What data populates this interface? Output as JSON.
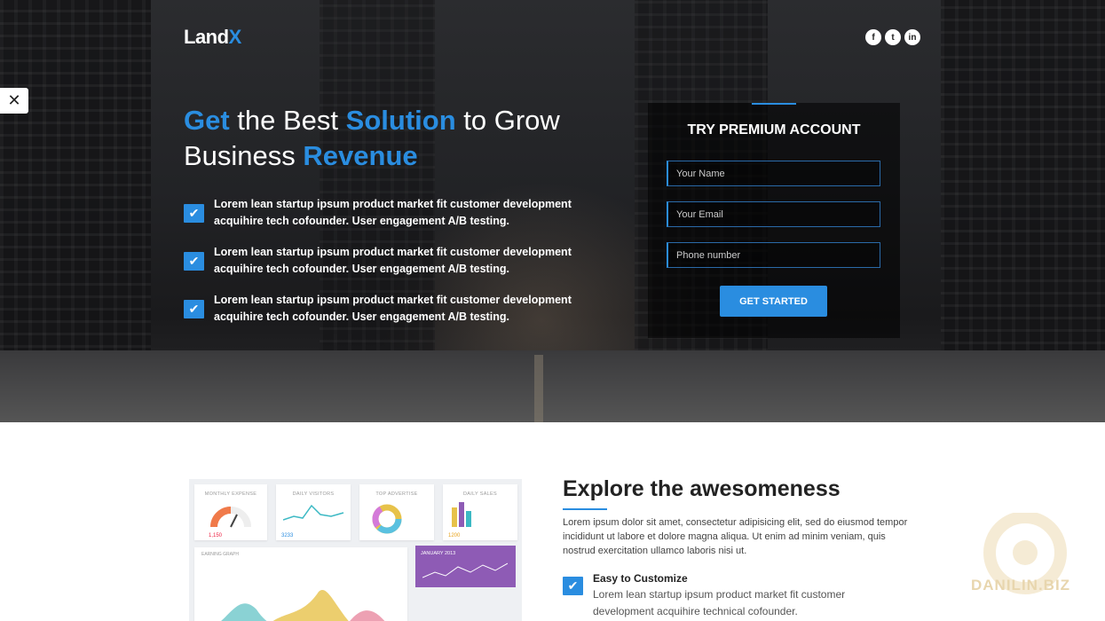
{
  "header": {
    "logo_main": "Land",
    "logo_accent": "X",
    "social": [
      {
        "icon": "facebook-icon",
        "glyph": "f"
      },
      {
        "icon": "twitter-icon",
        "glyph": "t"
      },
      {
        "icon": "linkedin-icon",
        "glyph": "in"
      }
    ]
  },
  "sidebar_tool": {
    "icon": "tools-icon",
    "glyph": "✕"
  },
  "hero": {
    "headline": {
      "w1": "Get",
      "w2": " the Best ",
      "w3": "Solution",
      "w4": " to Grow Business ",
      "w5": "Revenue"
    },
    "features": [
      {
        "text": "Lorem lean startup ipsum product market fit customer development acquihire tech cofounder. User engagement A/B testing."
      },
      {
        "text": "Lorem lean startup ipsum product market fit customer development acquihire tech cofounder. User engagement A/B testing."
      },
      {
        "text": "Lorem lean startup ipsum product market fit customer development acquihire tech cofounder. User engagement A/B testing."
      }
    ]
  },
  "signup": {
    "title": "TRY PREMIUM ACCOUNT",
    "name_placeholder": "Your Name",
    "email_placeholder": "Your Email",
    "phone_placeholder": "Phone number",
    "cta_label": "GET STARTED"
  },
  "dashboard": {
    "cards": [
      {
        "title": "MONTHLY EXPENSE",
        "value": "1,150"
      },
      {
        "title": "DAILY VISITORS",
        "value": "3233"
      },
      {
        "title": "TOP ADVERTISE",
        "value": ""
      },
      {
        "title": "DAILY SALES",
        "value": "1200"
      }
    ],
    "earning_title": "EARNING GRAPH",
    "purple_title": "JANUARY 2013"
  },
  "explore": {
    "title": "Explore the awesomeness",
    "text": "Lorem ipsum dolor sit amet, consectetur adipisicing elit, sed do eiusmod tempor incididunt ut labore et dolore magna aliqua. Ut enim ad minim veniam, quis nostrud exercitation ullamco laboris nisi ut.",
    "item_title": "Easy to Customize",
    "item_text": "Lorem lean startup ipsum product market fit customer development acquihire technical cofounder."
  },
  "watermark": "DANILIN.BIZ",
  "colors": {
    "accent": "#2a8de0",
    "purple": "#8e5bb5"
  }
}
